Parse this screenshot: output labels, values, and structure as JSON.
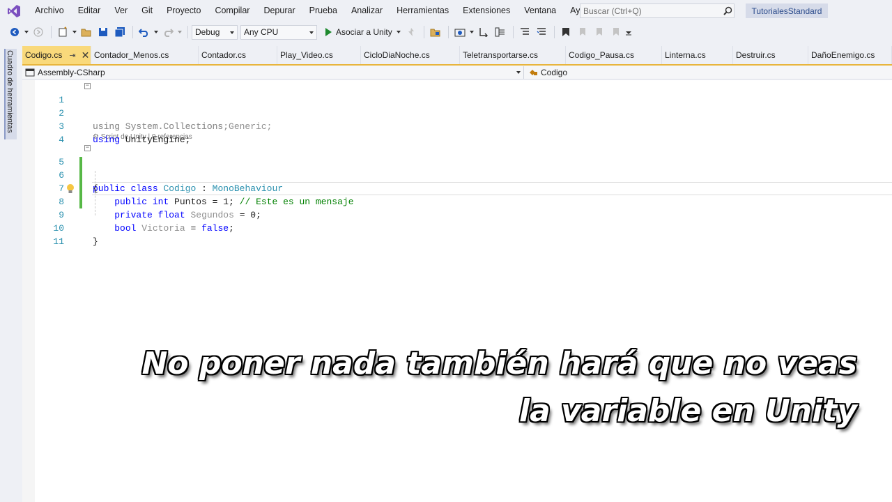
{
  "menu": {
    "items": [
      "Archivo",
      "Editar",
      "Ver",
      "Git",
      "Proyecto",
      "Compilar",
      "Depurar",
      "Prueba",
      "Analizar",
      "Herramientas",
      "Extensiones",
      "Ventana",
      "Ayuda"
    ],
    "search_placeholder": "Buscar (Ctrl+Q)",
    "solution_name": "TutorialesStandard"
  },
  "toolbar": {
    "configuration": "Debug",
    "platform": "Any CPU",
    "attach_label": "Asociar a Unity"
  },
  "left_panel": {
    "label": "Cuadro de herramientas"
  },
  "tabs": [
    {
      "label": "Codigo.cs",
      "active": true
    },
    {
      "label": "Contador_Menos.cs"
    },
    {
      "label": "Contador.cs"
    },
    {
      "label": "Play_Video.cs"
    },
    {
      "label": "CicloDiaNoche.cs"
    },
    {
      "label": "Teletransportarse.cs"
    },
    {
      "label": "Codigo_Pausa.cs"
    },
    {
      "label": "Linterna.cs"
    },
    {
      "label": "Destruir.cs"
    },
    {
      "label": "DañoEnemigo.cs"
    }
  ],
  "navbar": {
    "project": "Assembly-CSharp",
    "class": "Codigo"
  },
  "editor": {
    "codelens": "Script de Unity | 0 referencias",
    "lines": [
      {
        "n": "1",
        "text": "using System.Collections;"
      },
      {
        "n": "2",
        "text": "using System.Collections.Generic;"
      },
      {
        "n": "3",
        "text": "using UnityEngine;"
      },
      {
        "n": "4",
        "text": ""
      },
      {
        "n": "5",
        "text": "public class Codigo : MonoBehaviour"
      },
      {
        "n": "6",
        "text": "{"
      },
      {
        "n": "7",
        "text": "    public int Puntos = 1; // Este es un mensaje"
      },
      {
        "n": "8",
        "text": "    private float Segundos = 0;"
      },
      {
        "n": "9",
        "text": "    bool Victoria = false;"
      },
      {
        "n": "10",
        "text": "}"
      },
      {
        "n": "11",
        "text": ""
      }
    ]
  },
  "subtitle": {
    "line1": "No poner nada también hará que no veas",
    "line2": "la variable en Unity"
  }
}
